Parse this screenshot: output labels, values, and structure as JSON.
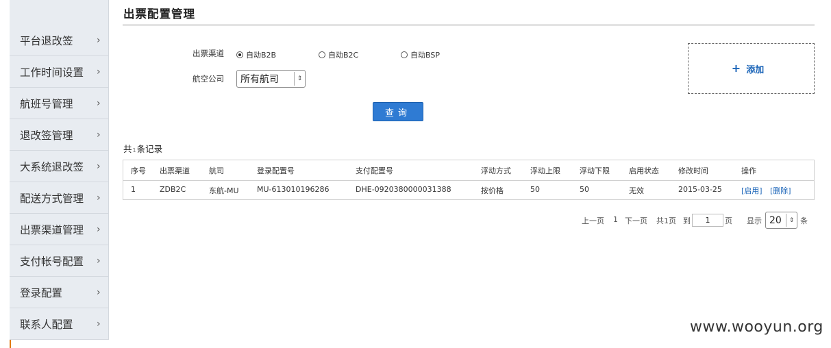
{
  "sidebar": {
    "items": [
      {
        "label": "平台退改签"
      },
      {
        "label": "工作时间设置"
      },
      {
        "label": "航班号管理"
      },
      {
        "label": "退改签管理"
      },
      {
        "label": "大系统退改签"
      },
      {
        "label": "配送方式管理"
      },
      {
        "label": "出票渠道管理"
      },
      {
        "label": "支付帐号配置"
      },
      {
        "label": "登录配置"
      },
      {
        "label": "联系人配置"
      }
    ],
    "chevron": "›"
  },
  "page": {
    "title": "出票配置管理"
  },
  "form": {
    "channel_label": "出票渠道",
    "channels": [
      {
        "label": "自动B2B",
        "selected": true
      },
      {
        "label": "自动B2C",
        "selected": false
      },
      {
        "label": "自动BSP",
        "selected": false
      }
    ],
    "airline_label": "航空公司",
    "airline_value": "所有航司",
    "query_label": "查询"
  },
  "add": {
    "plus": "+",
    "label": "添加"
  },
  "records": {
    "prefix": "共",
    "count": "1",
    "suffix": "条记录"
  },
  "table": {
    "headers": [
      "序号",
      "出票渠道",
      "航司",
      "登录配置号",
      "支付配置号",
      "浮动方式",
      "浮动上限",
      "浮动下限",
      "启用状态",
      "修改时间",
      "操作"
    ],
    "rows": [
      {
        "index": "1",
        "channel": "ZDB2C",
        "airline": "东航-MU",
        "login_id": "MU-613010196286",
        "pay_id": "DHE-0920380000031388",
        "float_mode": "按价格",
        "float_max": "50",
        "float_min": "50",
        "status": "无效",
        "modified": "2015-03-25",
        "action_enable": "[启用]",
        "action_delete": "[删除]"
      }
    ]
  },
  "pager": {
    "prev": "上一页",
    "current": "1",
    "next": "下一页",
    "total": "共1页",
    "goto_label": "到",
    "goto_value": "1",
    "page_unit": "页",
    "show_label": "显示",
    "page_size": "20",
    "size_unit": "条"
  },
  "watermark": "www.wooyun.org"
}
